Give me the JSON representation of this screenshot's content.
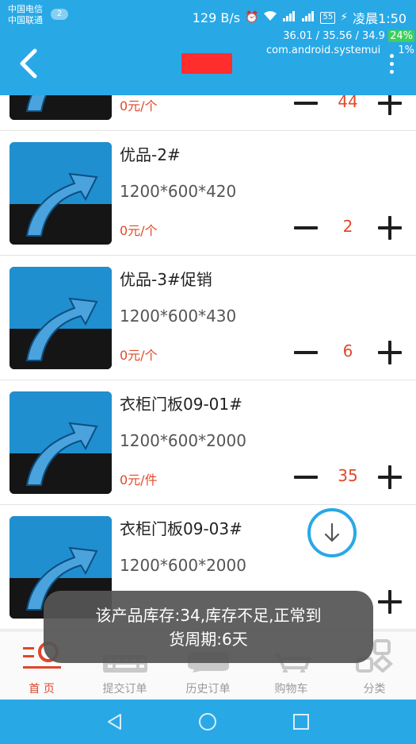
{
  "status_bar": {
    "carrier_1": "中国电信",
    "carrier_2": "中国联通",
    "notification_count": "2",
    "net_speed": "129 B/s",
    "battery": "55",
    "time": "凌晨1:50",
    "overlay_line_1": "36.01 / 35.56 / 34.9",
    "overlay_pct_1": "24%",
    "overlay_line_2": "com.android.systemui",
    "overlay_pct_2": "1%"
  },
  "products": [
    {
      "name": "",
      "spec": "",
      "price": "0元/个",
      "qty": "44"
    },
    {
      "name": "优品-2#",
      "spec": "1200*600*420",
      "price": "0元/个",
      "qty": "2"
    },
    {
      "name": "优品-3#促销",
      "spec": "1200*600*430",
      "price": "0元/个",
      "qty": "6"
    },
    {
      "name": "衣柜门板09-01#",
      "spec": "1200*600*2000",
      "price": "0元/件",
      "qty": "35"
    },
    {
      "name": "衣柜门板09-03#",
      "spec": "1200*600*2000",
      "price": "",
      "qty": ""
    }
  ],
  "toast": {
    "line_1": "该产品库存:34,库存不足,正常到",
    "line_2": "货周期:6天"
  },
  "tabs": [
    {
      "label": "首 页",
      "icon": "home-icon",
      "active": true
    },
    {
      "label": "提交订单",
      "icon": "keyboard-icon",
      "active": false
    },
    {
      "label": "历史订单",
      "icon": "chat-icon",
      "active": false
    },
    {
      "label": "购物车",
      "icon": "cart-icon",
      "active": false
    },
    {
      "label": "分类",
      "icon": "category-icon",
      "active": false
    }
  ],
  "colors": {
    "primary": "#29a8e6",
    "price": "#e04a2a",
    "active_tab": "#e0452a",
    "toast_bg": "#555555"
  }
}
